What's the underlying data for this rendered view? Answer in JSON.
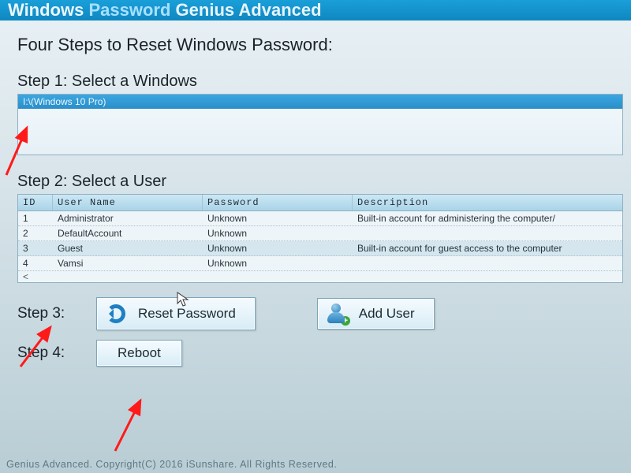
{
  "title": {
    "w1": "Windows",
    "w2": "Password",
    "w3": "Genius Advanced"
  },
  "heading": "Four Steps to Reset Windows Password:",
  "step1": {
    "label": "Step 1: Select a Windows",
    "items": [
      "I:\\(Windows 10 Pro)"
    ]
  },
  "step2": {
    "label": "Step 2: Select a User",
    "columns": {
      "id": "ID",
      "user": "User Name",
      "pass": "Password",
      "desc": "Description"
    },
    "rows": [
      {
        "id": "1",
        "user": "Administrator",
        "pass": "Unknown",
        "desc": "Built-in account for administering the computer/"
      },
      {
        "id": "2",
        "user": "DefaultAccount",
        "pass": "Unknown",
        "desc": ""
      },
      {
        "id": "3",
        "user": "Guest",
        "pass": "Unknown",
        "desc": "Built-in account for guest access to the computer"
      },
      {
        "id": "4",
        "user": "Vamsi",
        "pass": "Unknown",
        "desc": ""
      }
    ],
    "scroll_hint": "<"
  },
  "step3": {
    "label": "Step 3:",
    "reset_btn": "Reset Password",
    "add_btn": "Add User"
  },
  "step4": {
    "label": "Step 4:",
    "reboot_btn": "Reboot"
  },
  "footer": "Genius Advanced. Copyright(C) 2016 iSunshare. All Rights Reserved."
}
